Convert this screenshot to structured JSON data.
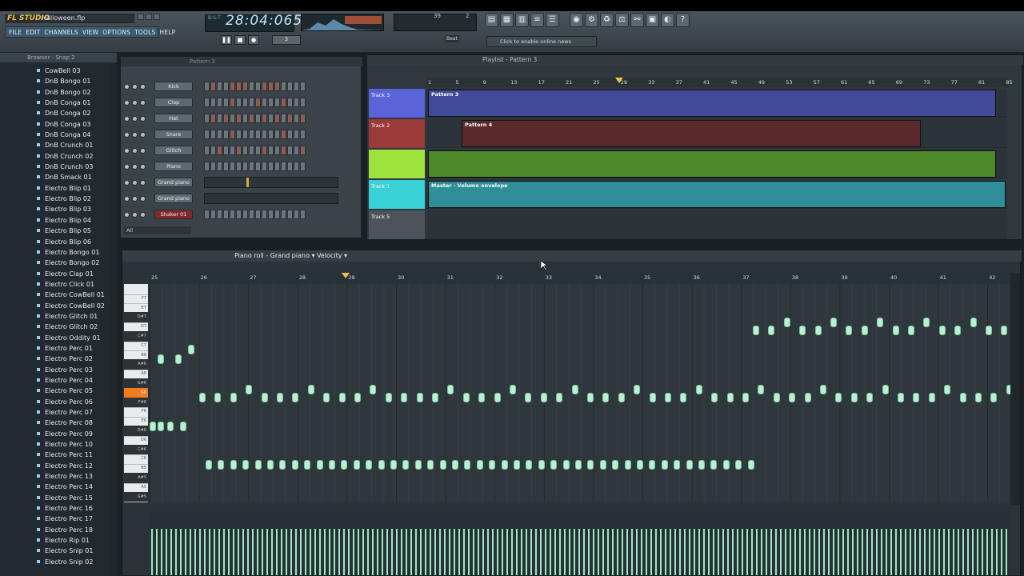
{
  "app": {
    "logo": "FL STUDIO",
    "filename": "Halloween.flp",
    "time": "28:04:065",
    "time_head": "B:S:T",
    "cpu": "39",
    "poly": "2",
    "tempo_label": "Beat",
    "online": "Click to enable online news"
  },
  "menu": [
    "FILE",
    "EDIT",
    "CHANNELS",
    "VIEW",
    "OPTIONS",
    "TOOLS",
    "HELP"
  ],
  "browser": {
    "title": "Browser - Snap 2",
    "items": [
      "CowBell 03",
      "DnB Bongo 01",
      "DnB Bongo 02",
      "DnB Conga 01",
      "DnB Conga 02",
      "DnB Conga 03",
      "DnB Conga 04",
      "DnB Crunch 01",
      "DnB Crunch 02",
      "DnB Crunch 03",
      "DnB Smack 01",
      "Electro Blip 01",
      "Electro Blip 02",
      "Electro Blip 03",
      "Electro Blip 04",
      "Electro Blip 05",
      "Electro Blip 06",
      "Electro Bongo 01",
      "Electro Bongo 02",
      "Electro Clap 01",
      "Electro Click 01",
      "Electro CowBell 01",
      "Electro CowBell 02",
      "Electro Glitch 01",
      "Electro Glitch 02",
      "Electro Oddity 01",
      "Electro Perc 01",
      "Electro Perc 02",
      "Electro Perc 03",
      "Electro Perc 04",
      "Electro Perc 05",
      "Electro Perc 06",
      "Electro Perc 07",
      "Electro Perc 08",
      "Electro Perc 09",
      "Electro Perc 10",
      "Electro Perc 11",
      "Electro Perc 12",
      "Electro Perc 13",
      "Electro Perc 14",
      "Electro Perc 15",
      "Electro Perc 16",
      "Electro Perc 17",
      "Electro Perc 18",
      "Electro Rip 01",
      "Electro Snip 01",
      "Electro Snip 02"
    ]
  },
  "stepseq": {
    "title": "Pattern 3",
    "filter": "All",
    "channels": [
      "Kick",
      "Clap",
      "Hat",
      "Snare",
      "Glitch",
      "Piano",
      "Grand piano",
      "Grand piano",
      "Shaker 01"
    ]
  },
  "playlist": {
    "title": "Playlist - Pattern 3",
    "ticks": [
      "1",
      "5",
      "9",
      "13",
      "17",
      "21",
      "25",
      "29",
      "33",
      "37",
      "41",
      "45",
      "49",
      "53",
      "57",
      "61",
      "65",
      "69",
      "73",
      "77",
      "81",
      "85"
    ],
    "tracks": [
      {
        "name": "Track 3",
        "color": "#5a63d8"
      },
      {
        "name": "Track 2",
        "color": "#9a3a3a"
      },
      {
        "name": "",
        "color": "#9ee23c"
      },
      {
        "name": "Track 1",
        "color": "#3ad0d8"
      },
      {
        "name": "Track 5",
        "color": "#4a545a"
      }
    ],
    "clips": {
      "pattern3": "Pattern 3",
      "pattern4": "Pattern 4",
      "envelope": "Master - Volume envelope"
    }
  },
  "pianoroll": {
    "title": "Piano roll - Grand piano",
    "mode": "Velocity",
    "ticks": [
      "25",
      "26",
      "27",
      "28",
      "29",
      "30",
      "31",
      "32",
      "33",
      "34",
      "35",
      "36",
      "37",
      "38",
      "39",
      "40",
      "41",
      "42"
    ],
    "keys": [
      "",
      "F7",
      "E7",
      "D#7",
      "D7",
      "C#7",
      "C7",
      "B6",
      "A#6",
      "A6",
      "G#6",
      "G6",
      "F#6",
      "F6",
      "E6",
      "D#6",
      "D6",
      "C#6",
      "C6",
      "B5",
      "A#5",
      "A5",
      "G#5"
    ]
  },
  "colors": {
    "accent": "#f07b20",
    "note": "#b9f1d3"
  }
}
